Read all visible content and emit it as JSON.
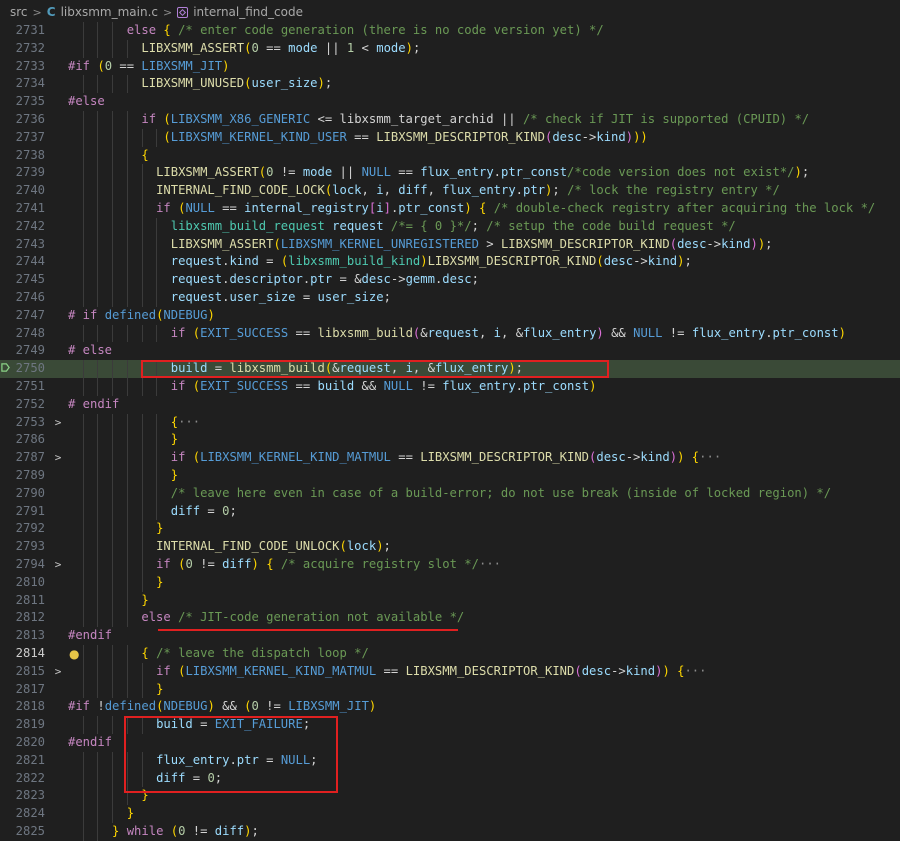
{
  "breadcrumb": {
    "folder": "src",
    "file": "libxsmm_main.c",
    "symbol": "internal_find_code"
  },
  "colors": {
    "highlight": "#3a4a37",
    "annotation": "#e02020"
  },
  "lines": [
    {
      "n": "2731",
      "t": "        else { /* enter code generation (there is no code version yet) */"
    },
    {
      "n": "2732",
      "t": "          LIBXSMM_ASSERT(0 == mode || 1 < mode);"
    },
    {
      "n": "2733",
      "t": "#if (0 == LIBXSMM_JIT)"
    },
    {
      "n": "2734",
      "t": "          LIBXSMM_UNUSED(user_size);"
    },
    {
      "n": "2735",
      "t": "#else"
    },
    {
      "n": "2736",
      "t": "          if (LIBXSMM_X86_GENERIC <= libxsmm_target_archid || /* check if JIT is supported (CPUID) */"
    },
    {
      "n": "2737",
      "t": "             (LIBXSMM_KERNEL_KIND_USER == LIBXSMM_DESCRIPTOR_KIND(desc->kind)))"
    },
    {
      "n": "2738",
      "t": "          {"
    },
    {
      "n": "2739",
      "t": "            LIBXSMM_ASSERT(0 != mode || NULL == flux_entry.ptr_const/*code version does not exist*/);"
    },
    {
      "n": "2740",
      "t": "            INTERNAL_FIND_CODE_LOCK(lock, i, diff, flux_entry.ptr); /* lock the registry entry */"
    },
    {
      "n": "2741",
      "t": "            if (NULL == internal_registry[i].ptr_const) { /* double-check registry after acquiring the lock */"
    },
    {
      "n": "2742",
      "t": "              libxsmm_build_request request /*= { 0 }*/; /* setup the code build request */"
    },
    {
      "n": "2743",
      "t": "              LIBXSMM_ASSERT(LIBXSMM_KERNEL_UNREGISTERED > LIBXSMM_DESCRIPTOR_KIND(desc->kind));"
    },
    {
      "n": "2744",
      "t": "              request.kind = (libxsmm_build_kind)LIBXSMM_DESCRIPTOR_KIND(desc->kind);"
    },
    {
      "n": "2745",
      "t": "              request.descriptor.ptr = &desc->gemm.desc;"
    },
    {
      "n": "2746",
      "t": "              request.user_size = user_size;"
    },
    {
      "n": "2747",
      "t": "# if defined(NDEBUG)"
    },
    {
      "n": "2748",
      "t": "              if (EXIT_SUCCESS == libxsmm_build(&request, i, &flux_entry) && NULL != flux_entry.ptr_const)"
    },
    {
      "n": "2749",
      "t": "# else"
    },
    {
      "n": "2750",
      "t": "              build = libxsmm_build(&request, i, &flux_entry);"
    },
    {
      "n": "2751",
      "t": "              if (EXIT_SUCCESS == build && NULL != flux_entry.ptr_const)"
    },
    {
      "n": "2752",
      "t": "# endif"
    },
    {
      "n": "2753",
      "t": "              {···"
    },
    {
      "n": "2786",
      "t": "              }"
    },
    {
      "n": "2787",
      "t": "              if (LIBXSMM_KERNEL_KIND_MATMUL == LIBXSMM_DESCRIPTOR_KIND(desc->kind)) {···"
    },
    {
      "n": "2789",
      "t": "              }"
    },
    {
      "n": "2790",
      "t": "              /* leave here even in case of a build-error; do not use break (inside of locked region) */"
    },
    {
      "n": "2791",
      "t": "              diff = 0;"
    },
    {
      "n": "2792",
      "t": "            }"
    },
    {
      "n": "2793",
      "t": "            INTERNAL_FIND_CODE_UNLOCK(lock);"
    },
    {
      "n": "2794",
      "t": "            if (0 != diff) { /* acquire registry slot */···"
    },
    {
      "n": "2810",
      "t": "            }"
    },
    {
      "n": "2811",
      "t": "          }"
    },
    {
      "n": "2812",
      "t": "          else /* JIT-code generation not available */"
    },
    {
      "n": "2813",
      "t": "#endif"
    },
    {
      "n": "2814",
      "t": "          { /* leave the dispatch loop */"
    },
    {
      "n": "2815",
      "t": "            if (LIBXSMM_KERNEL_KIND_MATMUL == LIBXSMM_DESCRIPTOR_KIND(desc->kind)) {···"
    },
    {
      "n": "2817",
      "t": "            }"
    },
    {
      "n": "2818",
      "t": "#if !defined(NDEBUG) && (0 != LIBXSMM_JIT)"
    },
    {
      "n": "2819",
      "t": "            build = EXIT_FAILURE;"
    },
    {
      "n": "2820",
      "t": "#endif"
    },
    {
      "n": "2821",
      "t": "            flux_entry.ptr = NULL;"
    },
    {
      "n": "2822",
      "t": "            diff = 0;"
    },
    {
      "n": "2823",
      "t": "          }"
    },
    {
      "n": "2824",
      "t": "        }"
    },
    {
      "n": "2825",
      "t": "      } while (0 != diff);"
    }
  ]
}
